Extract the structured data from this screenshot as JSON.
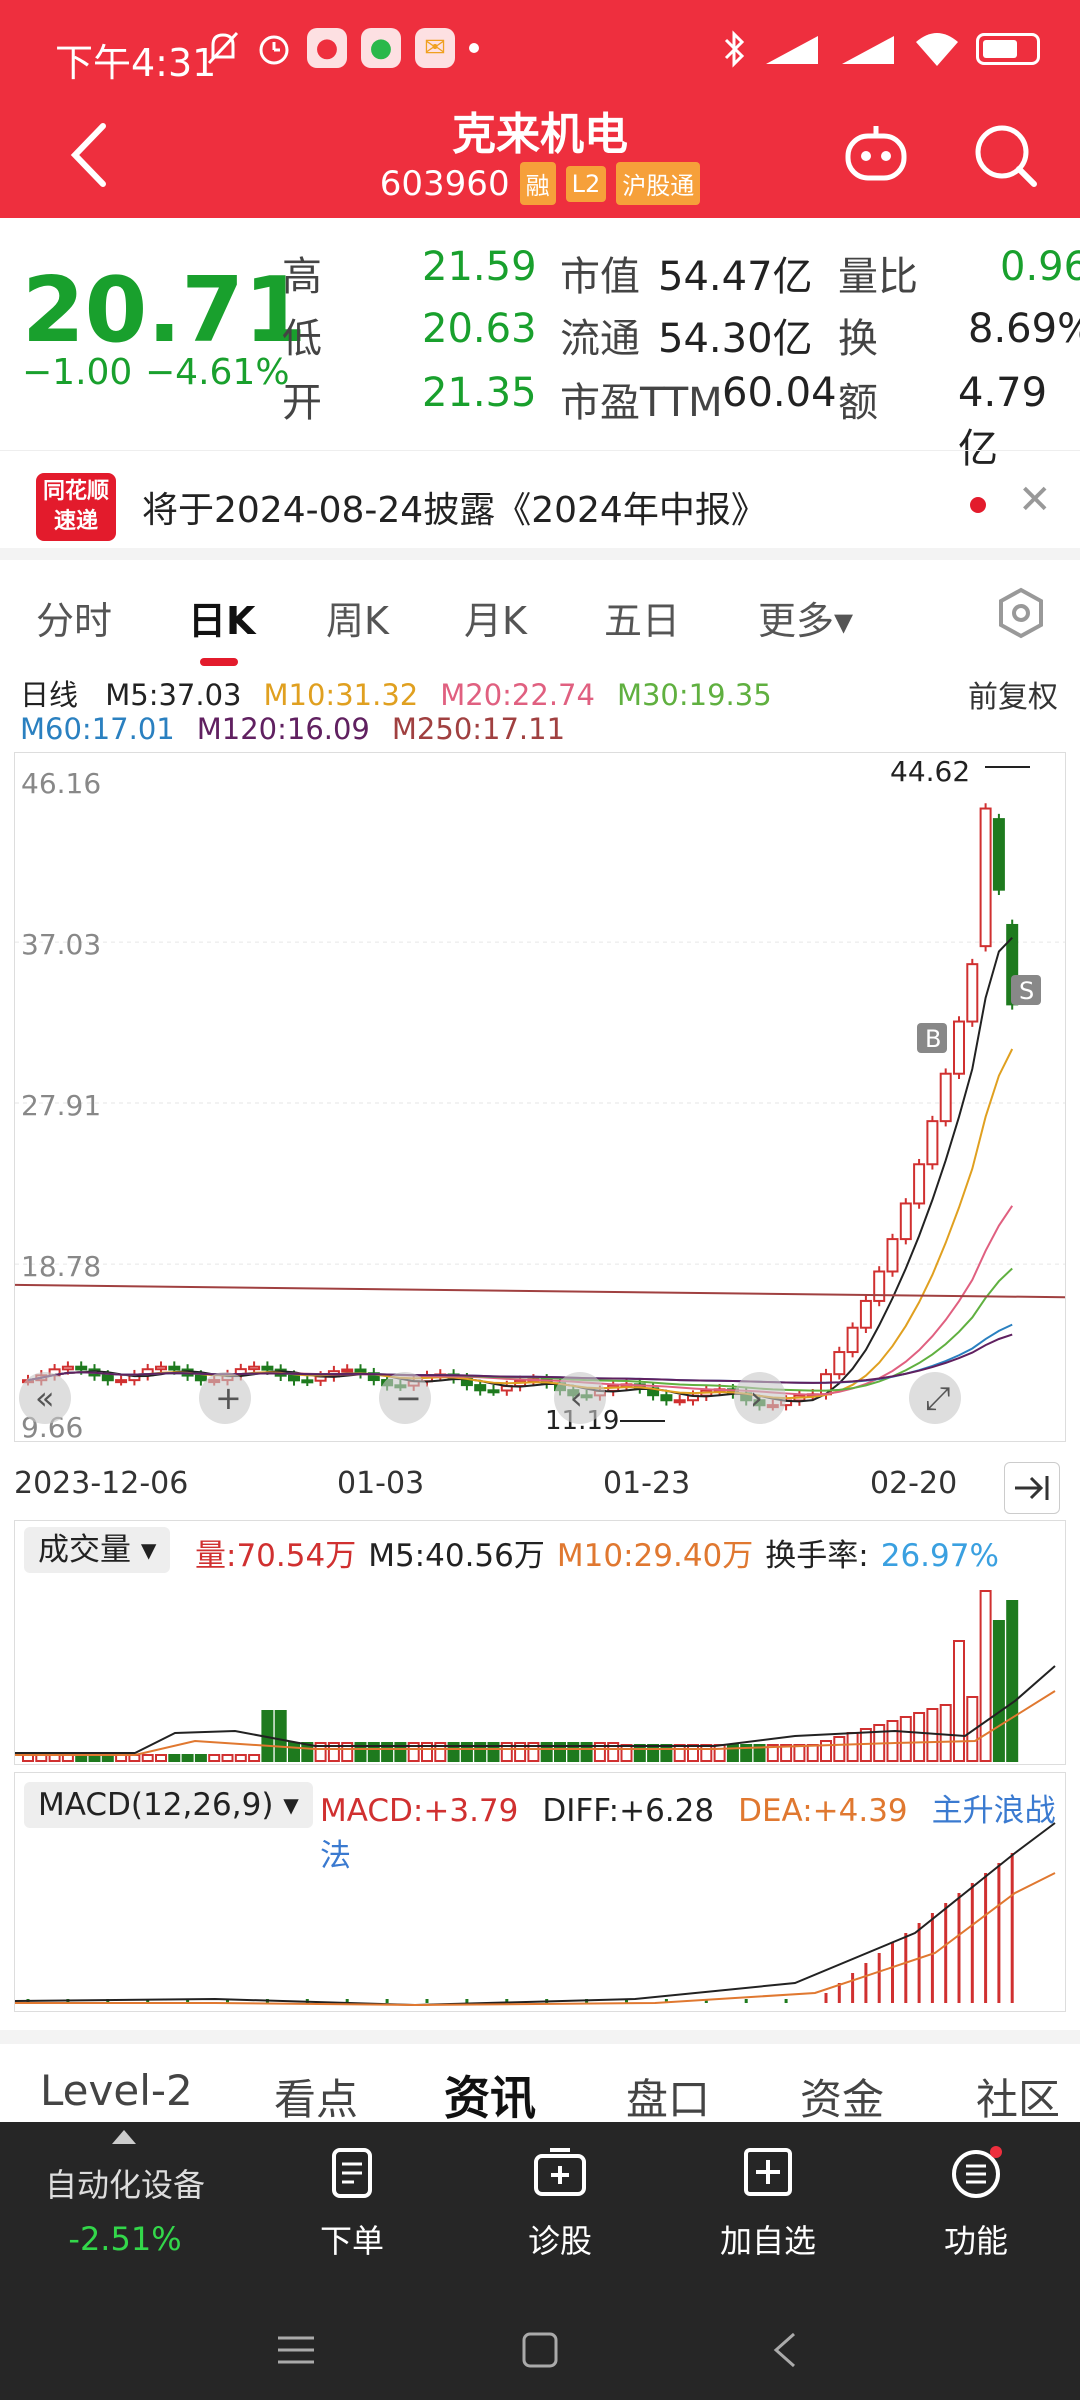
{
  "status": {
    "time": "下午4:31"
  },
  "header": {
    "title": "克来机电",
    "code": "603960",
    "badges": [
      "融",
      "L2",
      "沪股通"
    ]
  },
  "quote": {
    "price": "20.71",
    "change": "−1.00",
    "change_pct": "−4.61%",
    "rows": [
      [
        {
          "label": "高",
          "value": "21.59"
        },
        {
          "label": "市值",
          "value": "54.47亿"
        },
        {
          "label": "量比",
          "value": "0.96"
        }
      ],
      [
        {
          "label": "低",
          "value": "20.63"
        },
        {
          "label": "流通",
          "value": "54.30亿"
        },
        {
          "label": "换",
          "value": "8.69%"
        }
      ],
      [
        {
          "label": "开",
          "value": "21.35"
        },
        {
          "label": "市盈TTM",
          "value": "60.04"
        },
        {
          "label": "额",
          "value": "4.79亿"
        }
      ]
    ]
  },
  "notice": {
    "logo_line1": "同花顺",
    "logo_line2": "速递",
    "text": "将于2024-08-24披露《2024年中报》"
  },
  "tabs": [
    "分时",
    "日K",
    "周K",
    "月K",
    "五日",
    "更多▾"
  ],
  "ma": {
    "label": "日线",
    "row1": [
      {
        "t": "M5:37.03",
        "c": "#222"
      },
      {
        "t": "M10:31.32",
        "c": "#e0a020"
      },
      {
        "t": "M20:22.74",
        "c": "#e06080"
      },
      {
        "t": "M30:19.35",
        "c": "#60b040"
      }
    ],
    "row2": [
      {
        "t": "M60:17.01",
        "c": "#2a80c0"
      },
      {
        "t": "M120:16.09",
        "c": "#602060"
      },
      {
        "t": "M250:17.11",
        "c": "#a04040"
      }
    ],
    "fuquan": "前复权"
  },
  "kline": {
    "y_labels": [
      "46.16",
      "37.03",
      "27.91",
      "18.78",
      "9.66"
    ],
    "high_label": "44.62",
    "low_label": "11.19",
    "b_label": "B",
    "s_label": "S",
    "x_labels": [
      "2023-12-06",
      "01-03",
      "01-23",
      "02-20"
    ]
  },
  "volume": {
    "select": "成交量 ▾",
    "items": [
      {
        "t": "量:70.54万",
        "c": "#d03030"
      },
      {
        "t": "M5:40.56万",
        "c": "#222"
      },
      {
        "t": "M10:29.40万",
        "c": "#e07830"
      },
      {
        "t": "换手率:",
        "c": "#222"
      },
      {
        "t": "26.97%",
        "c": "#3aa0e0"
      }
    ]
  },
  "macd": {
    "select": "MACD(12,26,9) ▾",
    "items": [
      {
        "t": "MACD:+3.79",
        "c": "#d03030"
      },
      {
        "t": "DIFF:+6.28",
        "c": "#222"
      },
      {
        "t": "DEA:+4.39",
        "c": "#e07830"
      },
      {
        "t": "主升浪战法",
        "c": "#3a7ad0"
      }
    ]
  },
  "bottom_tabs": [
    "Level-2",
    "看点",
    "资讯",
    "盘口",
    "资金",
    "社区"
  ],
  "dock": {
    "sector": "自动化设备",
    "sector_chg": "-2.51%",
    "items": [
      "下单",
      "诊股",
      "加自选",
      "功能"
    ]
  }
}
